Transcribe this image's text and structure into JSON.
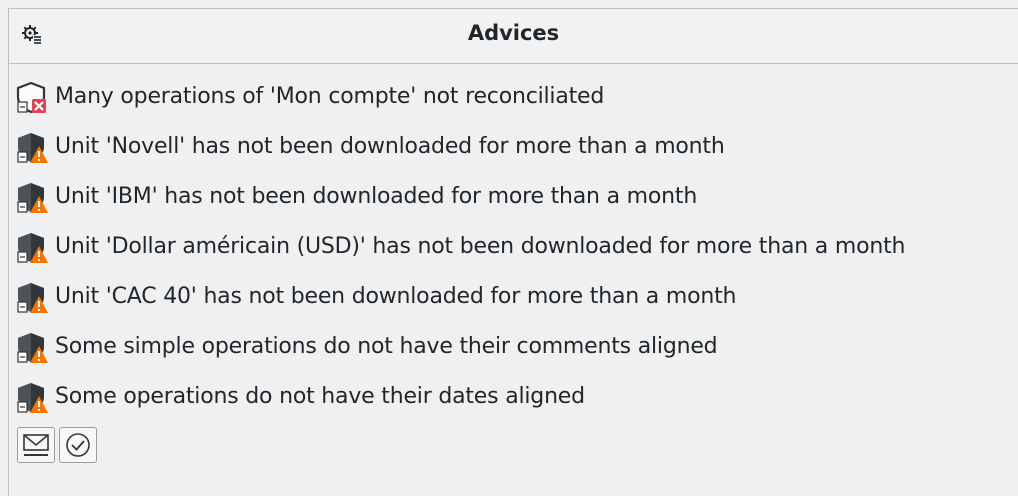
{
  "panel": {
    "title": "Advices",
    "settings_icon": "gear-list-icon"
  },
  "advices": [
    {
      "text": "Many operations of 'Mon compte' not reconciliated",
      "severity": "error",
      "icon": "shield-error-icon"
    },
    {
      "text": "Unit 'Novell' has not been downloaded for more than a month",
      "severity": "warning",
      "icon": "shield-warning-icon"
    },
    {
      "text": "Unit 'IBM' has not been downloaded for more than a month",
      "severity": "warning",
      "icon": "shield-warning-icon"
    },
    {
      "text": "Unit 'Dollar américain (USD)' has not been downloaded for more than a month",
      "severity": "warning",
      "icon": "shield-warning-icon"
    },
    {
      "text": "Unit 'CAC 40' has not been downloaded for more than a month",
      "severity": "warning",
      "icon": "shield-warning-icon"
    },
    {
      "text": "Some simple operations do not have their comments aligned",
      "severity": "warning",
      "icon": "shield-warning-icon"
    },
    {
      "text": "Some operations do not have their dates aligned",
      "severity": "warning",
      "icon": "shield-warning-icon"
    }
  ],
  "actions": [
    {
      "icon": "collapse-down-icon"
    },
    {
      "icon": "check-circle-icon"
    }
  ],
  "colors": {
    "error": "#da4453",
    "warning": "#f67400",
    "text": "#232629",
    "background": "#eff0f1"
  }
}
